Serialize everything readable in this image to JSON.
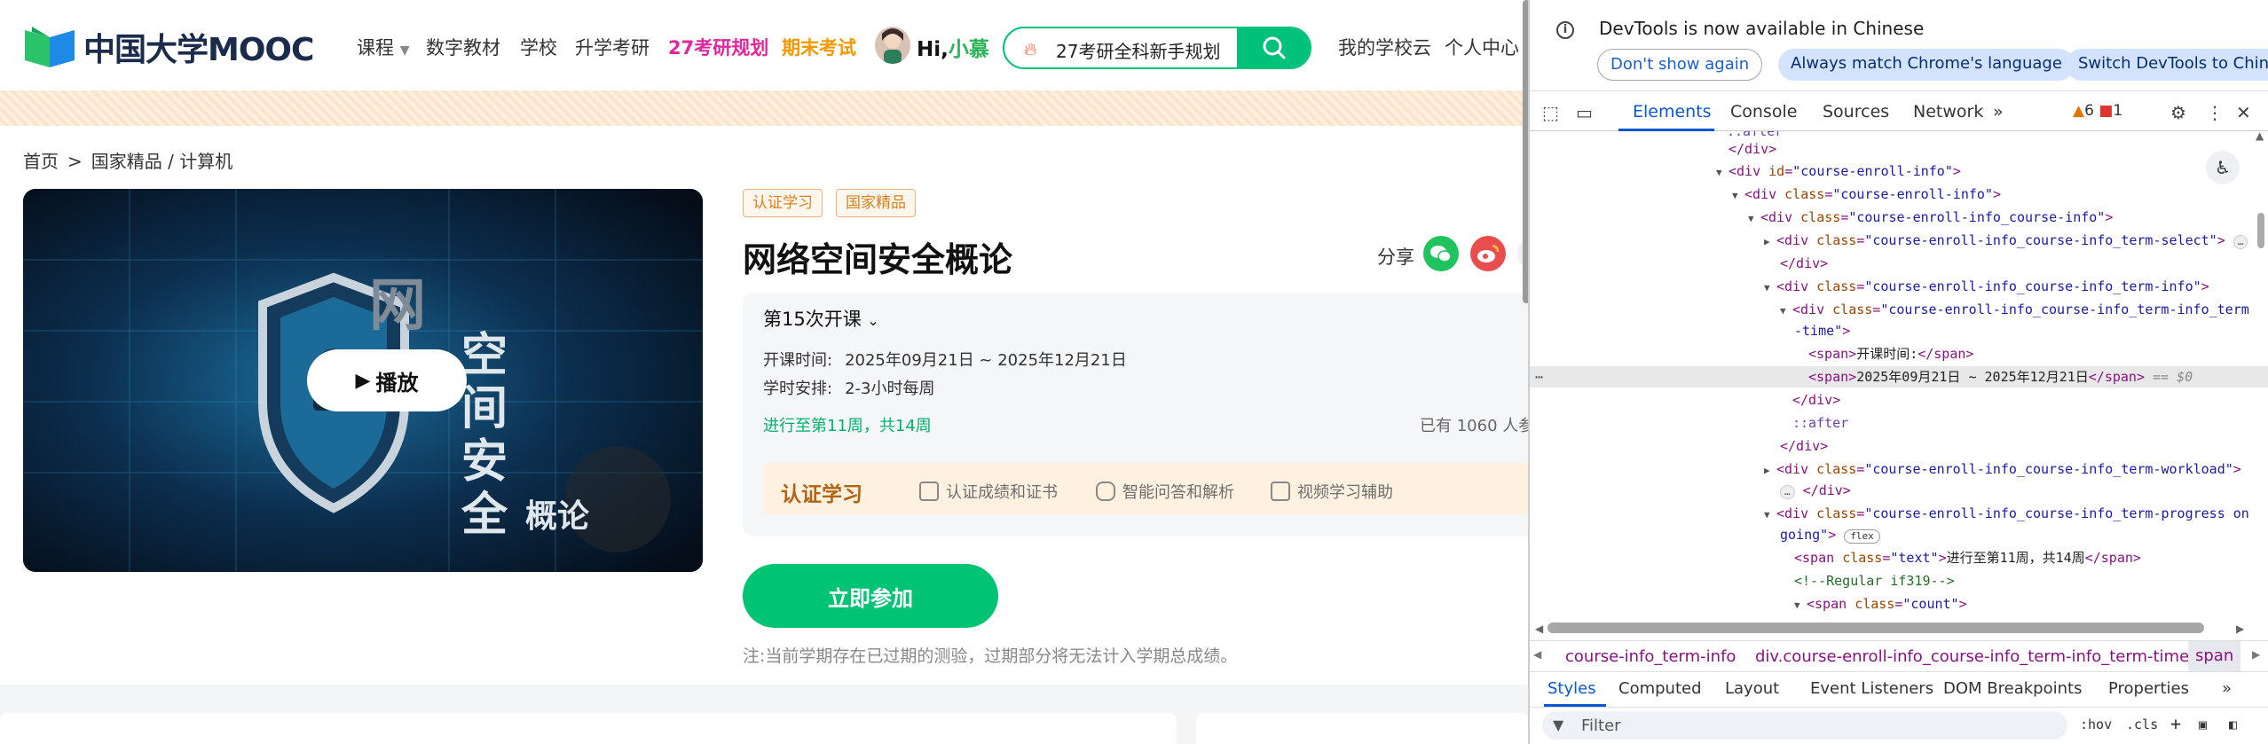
{
  "site": {
    "logo_text": "中国大学MOOC",
    "nav": [
      {
        "label": "课程",
        "style": "normal"
      },
      {
        "label": "数字教材",
        "style": "normal"
      },
      {
        "label": "学校",
        "style": "normal"
      },
      {
        "label": "升学考研",
        "style": "normal"
      },
      {
        "label": "27考研规划",
        "style": "hl1"
      },
      {
        "label": "期末考试",
        "style": "hl2"
      }
    ],
    "hi_prefix": "Hi,",
    "hi_name": "小慕",
    "search_value": "27考研全科新手规划",
    "right_nav": [
      "我的学校云",
      "个人中心"
    ]
  },
  "breadcrumb": {
    "home": "首页",
    "sep": ">",
    "path": "国家精品 / 计算机"
  },
  "video": {
    "play_label": "播放",
    "cover_chars": [
      "网",
      "空",
      "间",
      "安",
      "全",
      "概论"
    ]
  },
  "course": {
    "tags": [
      "认证学习",
      "国家精品"
    ],
    "title": "网络空间安全概论",
    "share_label": "分享",
    "term_select": "第15次开课",
    "term_time_label": "开课时间:",
    "term_time_value": "2025年09月21日 ~ 2025年12月21日",
    "workload_label": "学时安排:",
    "workload_value": "2-3小时每周",
    "progress_text": "进行至第11周，共14周",
    "enrolled_text": "已有 1060 人参",
    "cert_title": "认证学习",
    "cert_features": [
      "认证成绩和证书",
      "智能问答和解析",
      "视频学习辅助"
    ],
    "join_label": "立即参加",
    "note": "注:当前学期存在已过期的测验，过期部分将无法计入学期总成绩。"
  },
  "devtools": {
    "info_text": "DevTools is now available in Chinese",
    "buttons": [
      "Don't show again",
      "Always match Chrome's language",
      "Switch DevTools to Chin"
    ],
    "tabs": [
      "Elements",
      "Console",
      "Sources",
      "Network"
    ],
    "more_tabs": "»",
    "warn_count": "6",
    "err_count": "1",
    "dom": {
      "l0": "::after",
      "l1": "</div>",
      "l2_tag": "div",
      "l2_attr": "id",
      "l2_val": "\"course-enroll-info\"",
      "l3_tag": "div",
      "l3_attr": "class",
      "l3_val": "\"course-enroll-info\"",
      "l4_val": "\"course-enroll-info_course-info\"",
      "l5_val": "\"course-enroll-info_course-info_term-select\"",
      "l6": "</div>",
      "l7_val": "\"course-enroll-info_course-info_term-info\"",
      "l8_val": "\"course-enroll-info_course-info_term-info_term",
      "l8b": "-time\"",
      "l9_text": "开课时间:",
      "l10_text": "2025年09月21日 ~ 2025年12月21日",
      "eq0": "== $0",
      "l11": "</div>",
      "l12": "::after",
      "l13": "</div>",
      "l14_val": "\"course-enroll-info_course-info_term-workload\"",
      "l15": "</div>",
      "l16_val": "\"course-enroll-info_course-info_term-progress on",
      "l16b": "going\"",
      "flex": "flex",
      "l17_class": "\"text\"",
      "l17_text": "进行至第11周，共14周",
      "l18": "<!--Regular if319-->",
      "l19_class": "\"count\""
    },
    "crumbs": [
      "course-info_term-info",
      "div.course-enroll-info_course-info_term-info_term-time",
      "span"
    ],
    "subtabs": [
      "Styles",
      "Computed",
      "Layout",
      "Event Listeners",
      "DOM Breakpoints",
      "Properties"
    ],
    "filter_placeholder": "Filter",
    "hov": ":hov",
    "cls": ".cls"
  }
}
